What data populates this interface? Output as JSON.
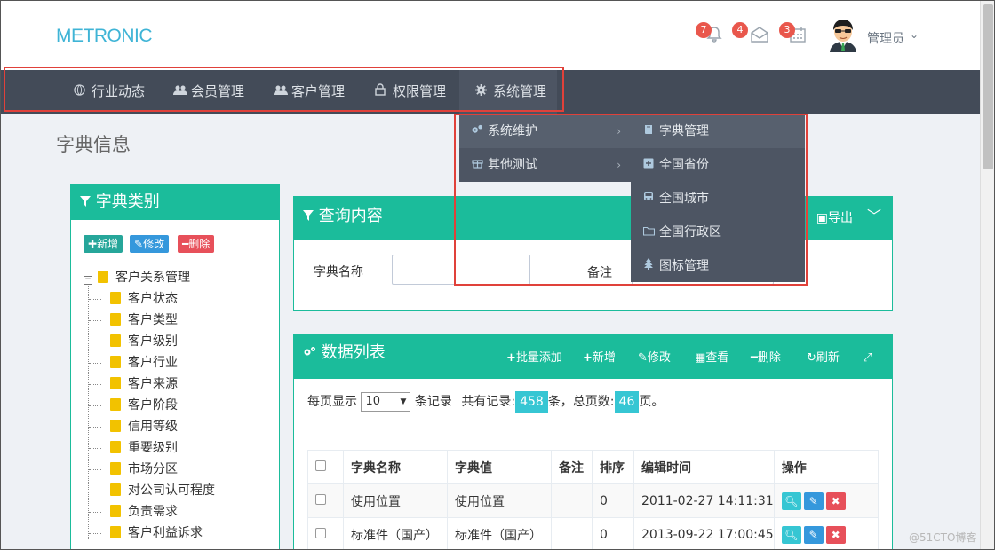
{
  "header": {
    "logo": "METRONIC",
    "notifications_count": "7",
    "inbox_count": "4",
    "tasks_count": "3",
    "user_name": "管理员"
  },
  "nav": {
    "items": [
      {
        "label": "行业动态",
        "icon": "globe-icon"
      },
      {
        "label": "会员管理",
        "icon": "users-icon"
      },
      {
        "label": "客户管理",
        "icon": "users-icon"
      },
      {
        "label": "权限管理",
        "icon": "lock-icon"
      },
      {
        "label": "系统管理",
        "icon": "gear-icon"
      }
    ]
  },
  "dropdown": {
    "level1": [
      {
        "label": "系统维护",
        "icon": "cogs-icon"
      },
      {
        "label": "其他测试",
        "icon": "gift-icon"
      }
    ],
    "level2": [
      {
        "label": "字典管理",
        "icon": "book-icon"
      },
      {
        "label": "全国省份",
        "icon": "plus-square-icon"
      },
      {
        "label": "全国城市",
        "icon": "bus-icon"
      },
      {
        "label": "全国行政区",
        "icon": "folder-icon"
      },
      {
        "label": "图标管理",
        "icon": "tree-icon"
      }
    ]
  },
  "page_title": "字典信息",
  "left_panel": {
    "title": "字典类别",
    "btn_add": "新增",
    "btn_edit": "修改",
    "btn_delete": "删除",
    "tree_root": "客户关系管理",
    "tree_children": [
      "客户状态",
      "客户类型",
      "客户级别",
      "客户行业",
      "客户来源",
      "客户阶段",
      "信用等级",
      "重要级别",
      "市场分区",
      "对公司认可程度",
      "负责需求",
      "客户利益诉求"
    ]
  },
  "query_panel": {
    "title": "查询内容",
    "export": "导出",
    "name_label": "字典名称",
    "remark_label": "备注"
  },
  "data_panel": {
    "title": "数据列表",
    "tools": [
      "批量添加",
      "新增",
      "修改",
      "查看",
      "删除",
      "刷新"
    ],
    "per_page_label": "每页显示",
    "per_page_value": "10",
    "records_suffix": "条记录",
    "total_label": "共有记录:",
    "total_records": "458",
    "pages_label": "条，总页数:",
    "total_pages": "46",
    "pages_suffix": "页。",
    "columns": [
      "字典名称",
      "字典值",
      "备注",
      "排序",
      "编辑时间",
      "操作"
    ],
    "rows": [
      {
        "name": "使用位置",
        "value": "使用位置",
        "remark": "",
        "order": "0",
        "time": "2011-02-27 14:11:31"
      },
      {
        "name": "标准件（国产）",
        "value": "标准件（国产）",
        "remark": "",
        "order": "0",
        "time": "2013-09-22 17:00:45"
      }
    ]
  },
  "watermark": "@51CTO博客",
  "colors": {
    "accent": "#1bbc9b",
    "nav_bg": "#434b58",
    "logo": "#3fb4d6",
    "badge": "#e9574c",
    "highlight": "#36c6d3",
    "highlight_box": "#e0413a"
  }
}
